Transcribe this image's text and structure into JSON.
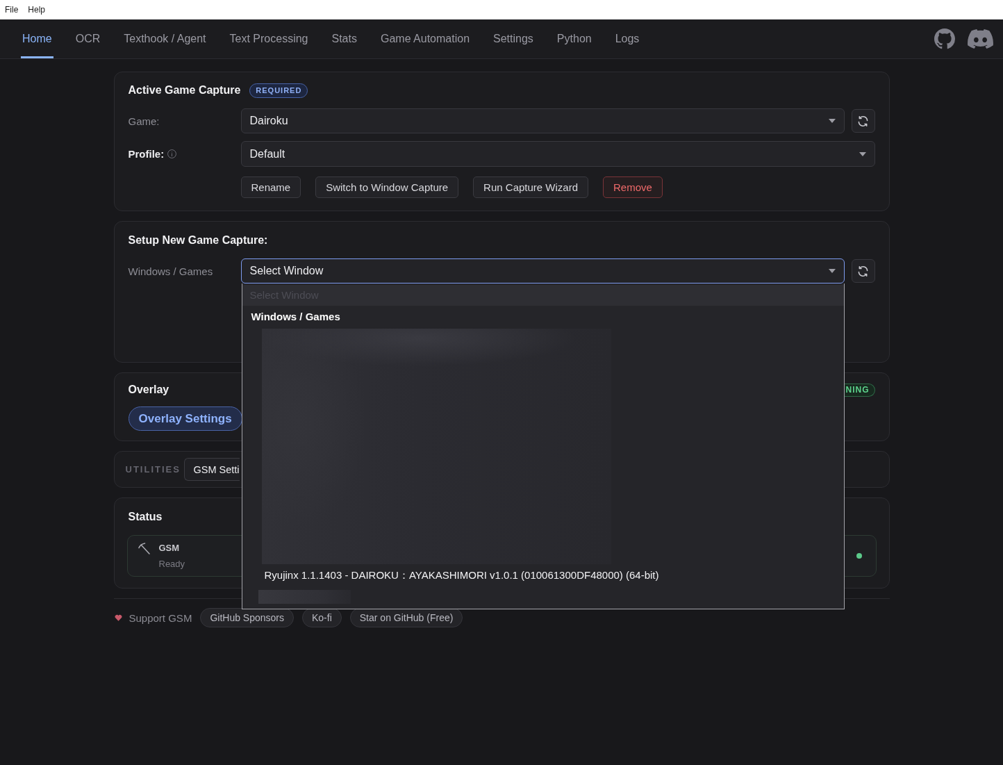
{
  "menu_bar": {
    "items": [
      "File",
      "Help"
    ]
  },
  "nav": {
    "tabs": [
      {
        "label": "Home",
        "selected": true
      },
      {
        "label": "OCR",
        "selected": false
      },
      {
        "label": "Texthook / Agent",
        "selected": false
      },
      {
        "label": "Text Processing",
        "selected": false
      },
      {
        "label": "Stats",
        "selected": false
      },
      {
        "label": "Game Automation",
        "selected": false
      },
      {
        "label": "Settings",
        "selected": false
      },
      {
        "label": "Python",
        "selected": false
      },
      {
        "label": "Logs",
        "selected": false
      }
    ]
  },
  "active_game_capture": {
    "title": "Active Game Capture",
    "badge": "REQUIRED",
    "game": {
      "label": "Game:",
      "value": "Dairoku"
    },
    "profile": {
      "label": "Profile:",
      "value": "Default"
    },
    "buttons": [
      {
        "label": "Rename",
        "kind": "default"
      },
      {
        "label": "Switch to Window Capture",
        "kind": "default"
      },
      {
        "label": "Run Capture Wizard",
        "kind": "default"
      },
      {
        "label": "Remove",
        "kind": "danger"
      }
    ]
  },
  "setup_new_game_capture": {
    "title": "Setup New Game Capture:",
    "window_select": {
      "label": "Windows / Games",
      "value": "Select Window",
      "expanded": true,
      "options": [
        {
          "kind": "placeholder",
          "label": "Select Window",
          "disabled": true
        },
        {
          "kind": "group",
          "label": "Windows / Games"
        },
        {
          "kind": "blurred_block"
        },
        {
          "kind": "option",
          "label": "Ryujinx 1.1.1403 - DAIROKU：AYAKASHIMORI v1.0.1 (010061300DF48000) (64-bit)",
          "disabled": false
        },
        {
          "kind": "blurred_line"
        }
      ]
    }
  },
  "overlay": {
    "title": "Overlay",
    "button": "Overlay Settings",
    "status_badge": "NING"
  },
  "utilities": {
    "label": "UTILITIES",
    "buttons": [
      "GSM Setti"
    ]
  },
  "status": {
    "title": "Status",
    "items": [
      {
        "name": "GSM",
        "state": "Ready",
        "color": "#5cc98a"
      }
    ]
  },
  "footer": {
    "label": "Support GSM",
    "links": [
      "GitHub Sponsors",
      "Ko-fi",
      "Star on GitHub (Free)"
    ]
  }
}
